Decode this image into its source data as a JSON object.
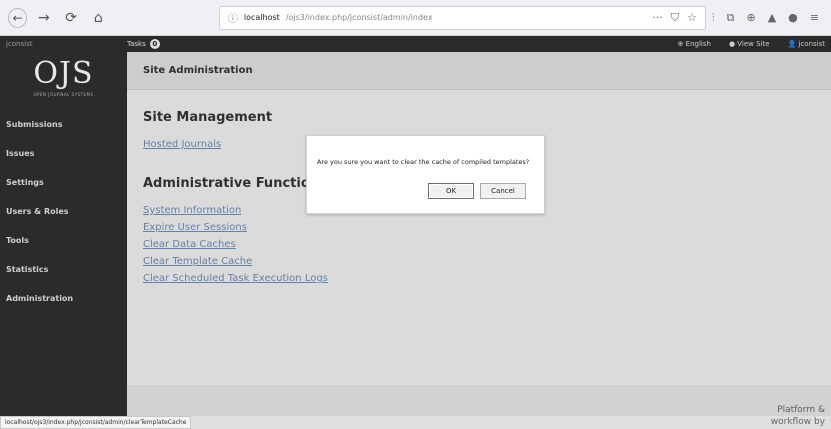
{
  "browser": {
    "nav": {
      "back": "←",
      "forward": "→",
      "reload": "⟳",
      "home": "⌂"
    },
    "url_host": "localhost",
    "url_path": "/ojs3/index.php/jconsist/admin/index",
    "page_actions": "···",
    "tools": [
      "⫶",
      "⧉",
      "⊕",
      "▲",
      "●",
      "≡"
    ]
  },
  "topbar": {
    "journal_name": "jconsist",
    "tasks_label": "Tasks",
    "tasks_count": "0",
    "language": "⊕ English",
    "view_site": "● View Site",
    "user": "👤 jconsist"
  },
  "sidebar": {
    "logo_mark": "OJS",
    "logo_sub": "OPEN JOURNAL SYSTEMS",
    "items": [
      {
        "label": "Submissions"
      },
      {
        "label": "Issues"
      },
      {
        "label": "Settings"
      },
      {
        "label": "Users & Roles"
      },
      {
        "label": "Tools"
      },
      {
        "label": "Statistics"
      },
      {
        "label": "Administration"
      }
    ]
  },
  "main": {
    "page_title": "Site Administration",
    "site_management": {
      "title": "Site Management",
      "links": [
        "Hosted Journals"
      ]
    },
    "admin_functions": {
      "title": "Administrative Functions",
      "links": [
        "System Information",
        "Expire User Sessions",
        "Clear Data Caches",
        "Clear Template Cache",
        "Clear Scheduled Task Execution Logs"
      ]
    }
  },
  "footer": {
    "platform_text": "Platform & workflow by"
  },
  "statusbar": {
    "text": "localhost/ojs3/index.php/jconsist/admin/clearTemplateCache"
  },
  "dialog": {
    "message": "Are you sure you want to clear the cache of compiled templates?",
    "ok_label": "OK",
    "cancel_label": "Cancel"
  }
}
